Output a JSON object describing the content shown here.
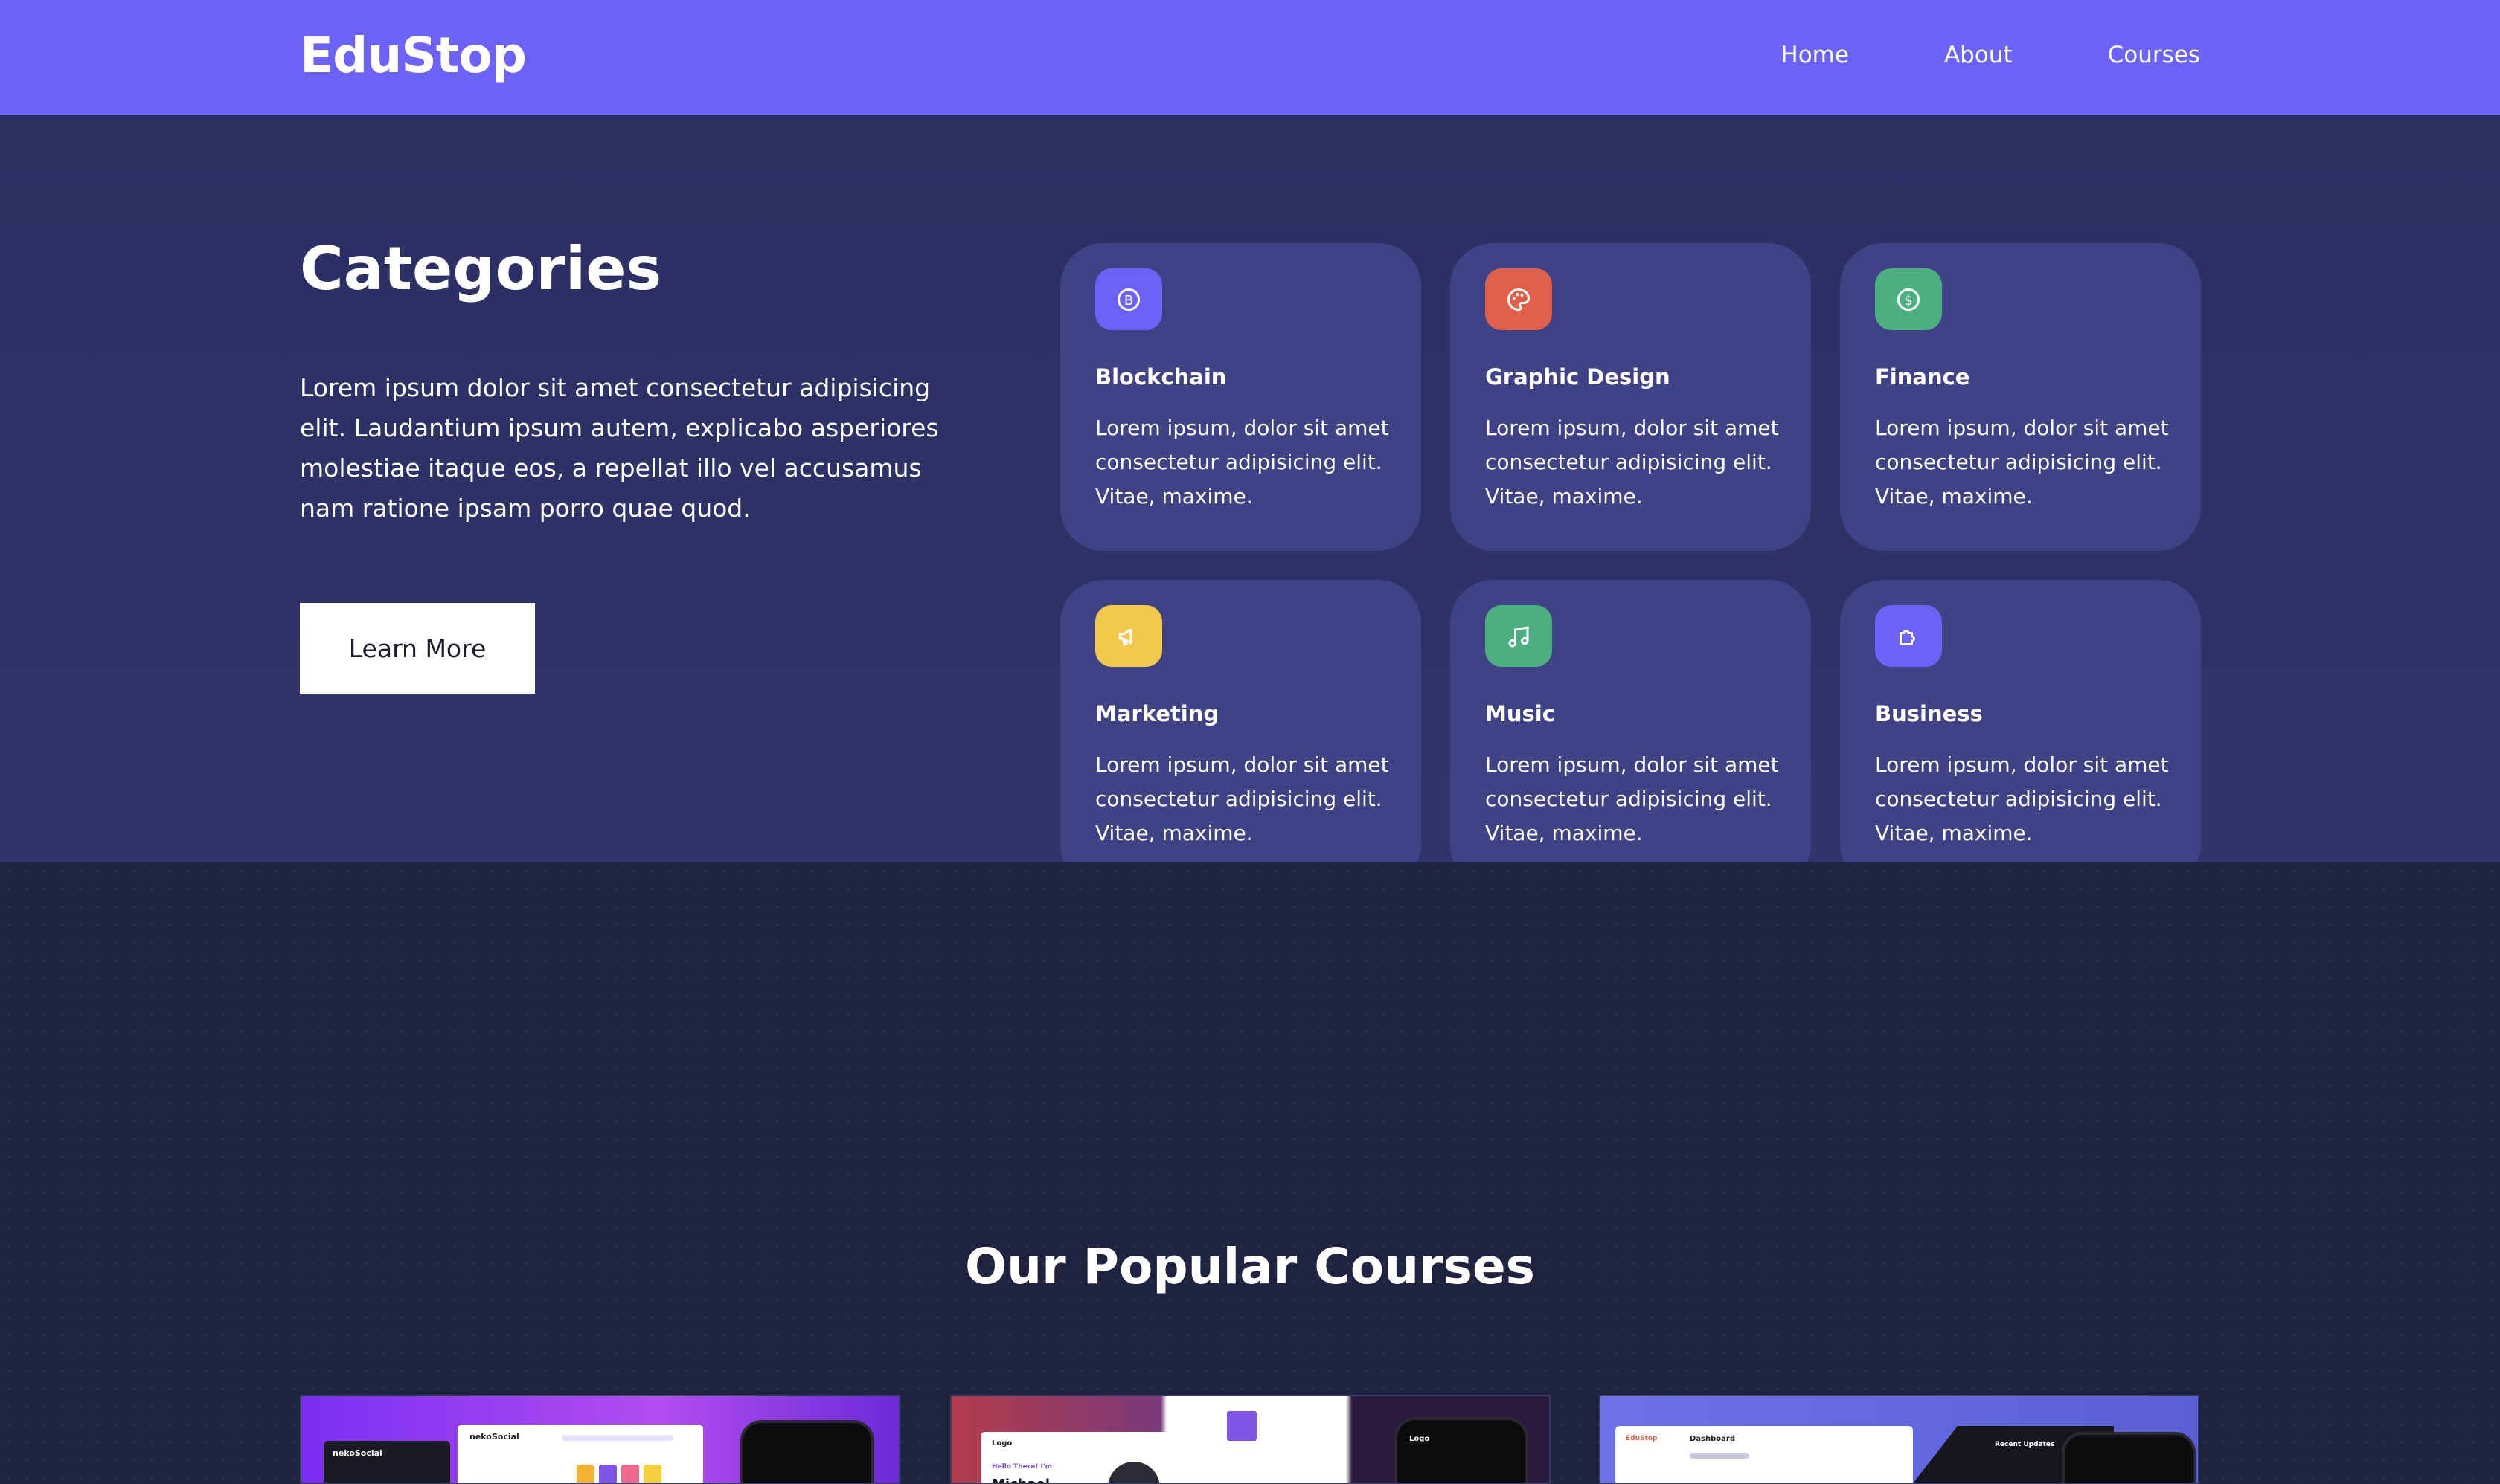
{
  "nav": {
    "brand": "EduStop",
    "links": [
      "Home",
      "About",
      "Courses"
    ]
  },
  "hero": {
    "title": "Categories",
    "text": "Lorem ipsum dolor sit amet consectetur adipisicing elit. Laudantium ipsum autem, explicabo asperiores molestiae itaque eos, a repellat illo vel accusamus nam ratione ipsam porro quae quod.",
    "button_label": "Learn More"
  },
  "categories": [
    {
      "title": "Blockchain",
      "desc": "Lorem ipsum, dolor sit amet consectetur adipisicing elit. Vitae, maxime.",
      "icon": "bitcoin-icon",
      "color": "#6c63f6"
    },
    {
      "title": "Graphic Design",
      "desc": "Lorem ipsum, dolor sit amet consectetur adipisicing elit. Vitae, maxime.",
      "icon": "palette-icon",
      "color": "#e0604a"
    },
    {
      "title": "Finance",
      "desc": "Lorem ipsum, dolor sit amet consectetur adipisicing elit. Vitae, maxime.",
      "icon": "dollar-icon",
      "color": "#4caf80"
    },
    {
      "title": "Marketing",
      "desc": "Lorem ipsum, dolor sit amet consectetur adipisicing elit. Vitae, maxime.",
      "icon": "megaphone-icon",
      "color": "#f2c94c"
    },
    {
      "title": "Music",
      "desc": "Lorem ipsum, dolor sit amet consectetur adipisicing elit. Vitae, maxime.",
      "icon": "music-icon",
      "color": "#4caf80"
    },
    {
      "title": "Business",
      "desc": "Lorem ipsum, dolor sit amet consectetur adipisicing elit. Vitae, maxime.",
      "icon": "puzzle-icon",
      "color": "#6c63f6"
    }
  ],
  "popular": {
    "title": "Our Popular Courses",
    "thumbs": [
      {
        "label_a": "nekoSocial",
        "label_b": "nekoSocial"
      },
      {
        "label_a": "Logo",
        "label_b": "Logo",
        "label_c": "Hello There! I'm",
        "label_d": "Michael"
      },
      {
        "label_a": "EduStop",
        "label_b": "Dashboard",
        "label_c": "Recent Updates"
      }
    ]
  },
  "colors": {
    "nav_bg": "#6c63f6",
    "hero_bg": "#2c2f62",
    "card_bg": "#3f4284",
    "lower_bg": "#1f2340"
  }
}
